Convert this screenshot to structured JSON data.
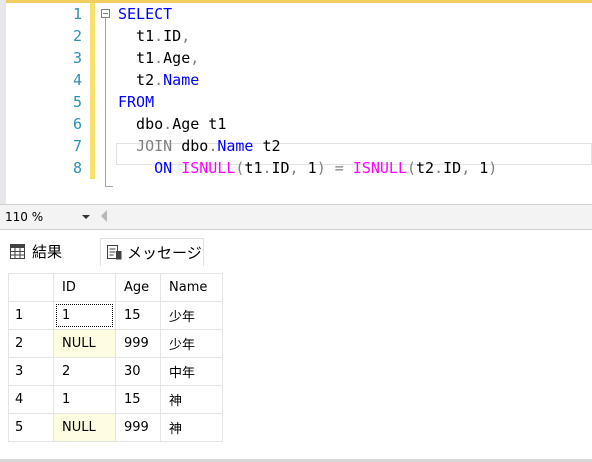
{
  "editor": {
    "line_numbers": [
      "1",
      "2",
      "3",
      "4",
      "5",
      "6",
      "7",
      "8"
    ]
  },
  "zoom": {
    "value": "110 %"
  },
  "tabs": {
    "results": "結果",
    "messages": "メッセージ"
  },
  "results": {
    "columns": [
      "ID",
      "Age",
      "Name"
    ],
    "rows": [
      {
        "num": "1",
        "id": "1",
        "age": "15",
        "name": "少年"
      },
      {
        "num": "2",
        "id": "NULL",
        "age": "999",
        "name": "少年"
      },
      {
        "num": "3",
        "id": "2",
        "age": "30",
        "name": "中年"
      },
      {
        "num": "4",
        "id": "1",
        "age": "15",
        "name": "神"
      },
      {
        "num": "5",
        "id": "NULL",
        "age": "999",
        "name": "神"
      }
    ]
  },
  "colors": {
    "keyword": "#0000ff",
    "function": "#ff00ff",
    "object": "#008080",
    "line_number": "#2b91af",
    "change_margin": "#f7e16b",
    "null_cell": "#fffde1"
  },
  "icons": [
    "collapse-icon",
    "grid-icon",
    "messages-icon",
    "dropdown-arrow-icon",
    "scroll-left-icon"
  ]
}
